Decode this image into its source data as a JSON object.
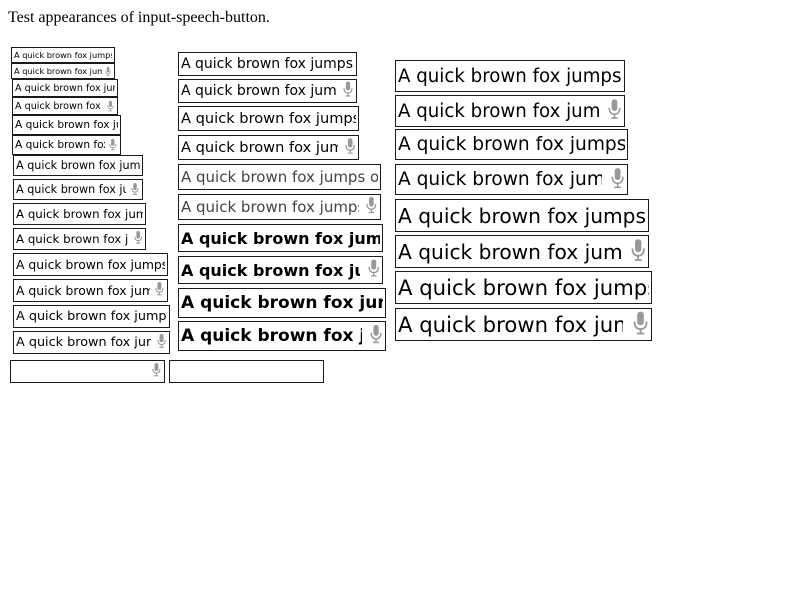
{
  "page": {
    "heading": "Test appearances of input-speech-button."
  },
  "sample_text": "A quick brown fox jumps over the lazy dog.",
  "icons": {
    "mic": "microphone-icon",
    "mic_color": "#999999"
  }
}
